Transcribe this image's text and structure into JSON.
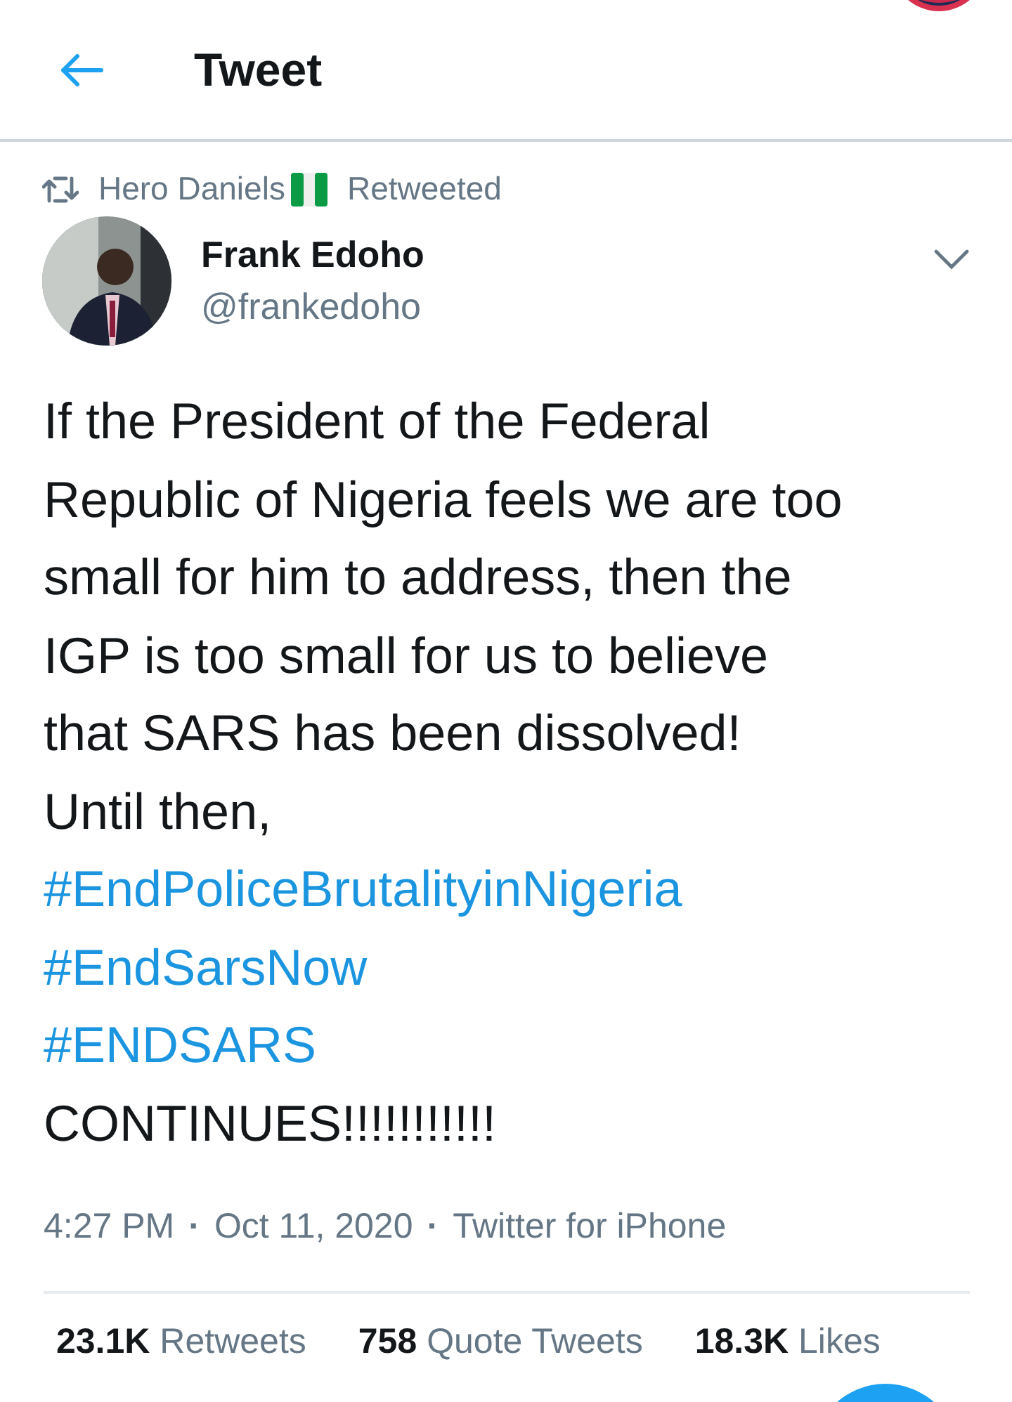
{
  "header": {
    "title": "Tweet"
  },
  "retweet_context": {
    "name": "Hero Daniels",
    "label": "Retweeted"
  },
  "author": {
    "name": "Frank Edoho",
    "handle": "@frankedoho"
  },
  "body": [
    {
      "kind": "text",
      "text": "If the President of the Federal"
    },
    {
      "kind": "text",
      "text": "Republic of Nigeria feels we are too"
    },
    {
      "kind": "text",
      "text": "small for him to address, then the"
    },
    {
      "kind": "text",
      "text": "IGP is too small for us to believe"
    },
    {
      "kind": "text",
      "text": "that SARS has been dissolved!"
    },
    {
      "kind": "text",
      "text": "Until then,"
    },
    {
      "kind": "hashtag",
      "text": "#EndPoliceBrutalityinNigeria"
    },
    {
      "kind": "hashtag",
      "text": "#EndSarsNow"
    },
    {
      "kind": "hashtag",
      "text": "#ENDSARS"
    },
    {
      "kind": "text",
      "text": "CONTINUES!!!!!!!!!!!"
    }
  ],
  "meta": [
    {
      "text": "4:27 PM"
    },
    {
      "kind": "separator",
      "text": "·"
    },
    {
      "text": "Oct 11, 2020"
    },
    {
      "kind": "separator",
      "text": "·"
    },
    {
      "text": "Twitter for iPhone"
    }
  ],
  "stats": [
    {
      "count": "23.1K",
      "label": "Retweets"
    },
    {
      "count": "758",
      "label": "Quote Tweets"
    },
    {
      "count": "18.3K",
      "label": "Likes"
    }
  ]
}
